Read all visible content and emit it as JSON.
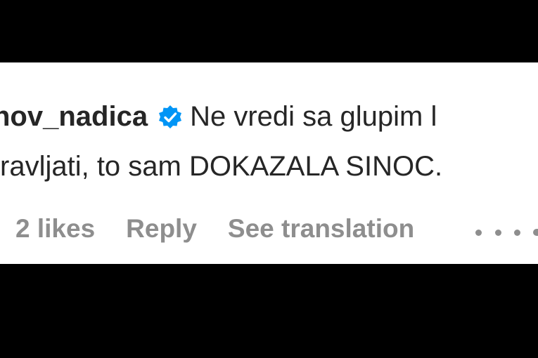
{
  "comment": {
    "username": "nov_nadica",
    "text_line1": "Ne vredi sa glupim l",
    "text_line2": "ravljati, to sam DOKAZALA SINOC."
  },
  "actions": {
    "likes": "2 likes",
    "reply": "Reply",
    "see_translation": "See translation"
  },
  "colors": {
    "badge": "#0095f6",
    "text": "#262626",
    "muted": "#8e8e8e"
  }
}
